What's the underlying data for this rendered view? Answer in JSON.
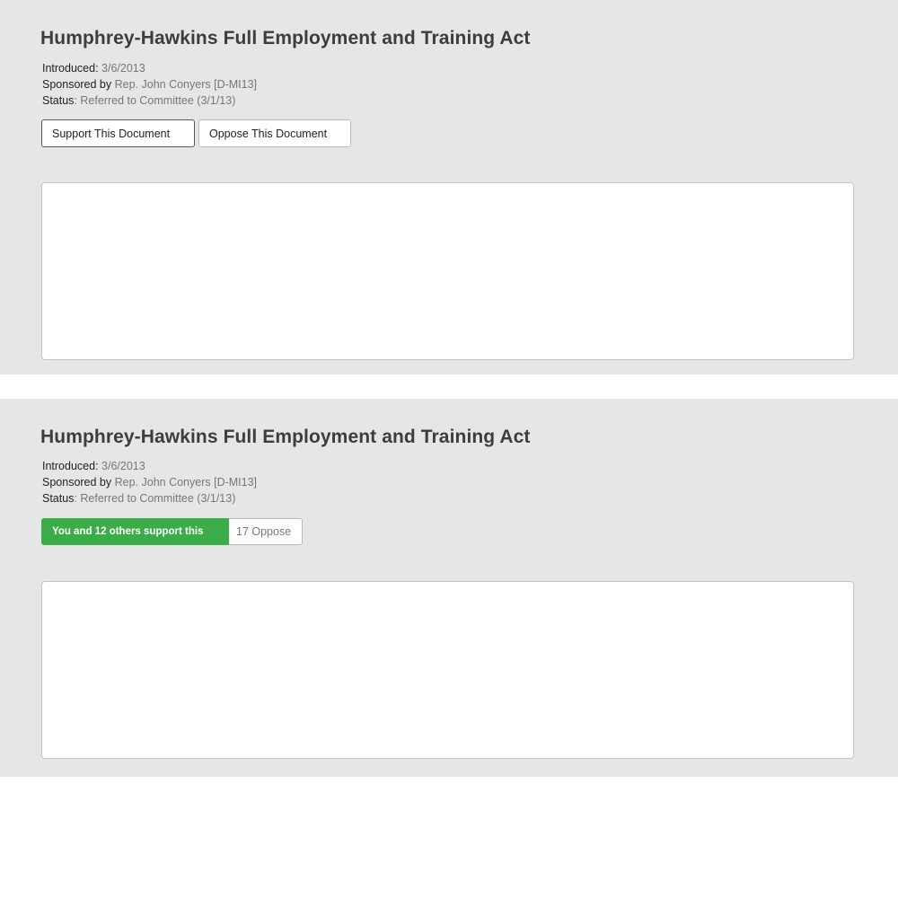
{
  "cards": [
    {
      "title": "Humphrey-Hawkins Full Employment and Training Act",
      "introduced_label": "Introduced:",
      "introduced_value": "3/6/2013",
      "sponsor_label": "Sponsored by",
      "sponsor_value": "Rep. John Conyers [D-MI13]",
      "status_label": "Status",
      "status_value": ": Referred to Committee (3/1/13)",
      "support_button": "Support This Document",
      "oppose_button": "Oppose This Document"
    },
    {
      "title": "Humphrey-Hawkins Full Employment and Training Act",
      "introduced_label": "Introduced:",
      "introduced_value": "3/6/2013",
      "sponsor_label": "Sponsored by",
      "sponsor_value": "Rep. John Conyers [D-MI13]",
      "status_label": "Status",
      "status_value": ": Referred to Committee (3/1/13)",
      "support_status": "You and 12 others support this",
      "oppose_count": "17 Oppose"
    }
  ],
  "colors": {
    "panel_bg": "#e5e6e8",
    "support_green": "#3aac48",
    "title_text": "#3d3d3d",
    "muted_text": "#777777"
  }
}
